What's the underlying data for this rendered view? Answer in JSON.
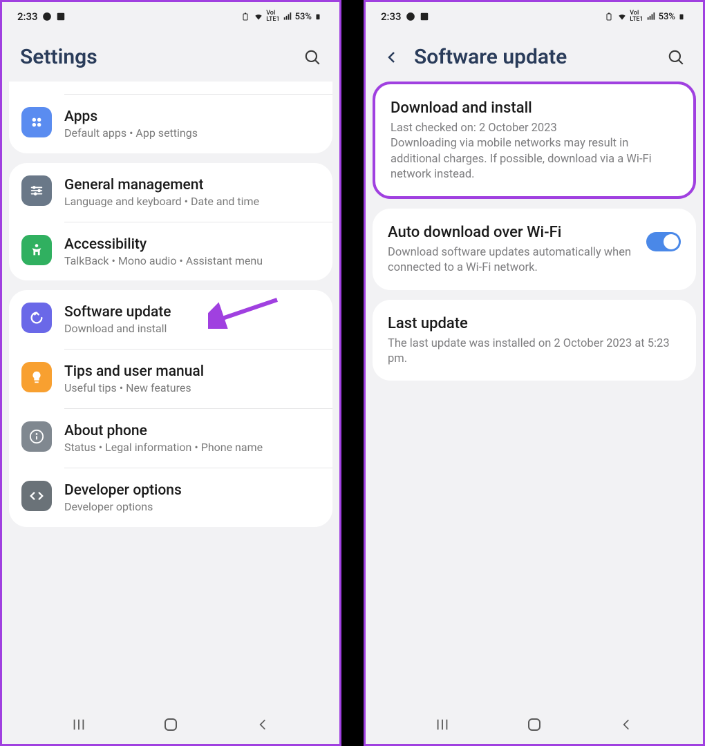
{
  "status": {
    "time": "2:33",
    "battery": "53%"
  },
  "left": {
    "title": "Settings",
    "apps": {
      "title": "Apps",
      "sub": "Default apps  •  App settings"
    },
    "general": {
      "title": "General management",
      "sub": "Language and keyboard  •  Date and time"
    },
    "accessibility": {
      "title": "Accessibility",
      "sub": "TalkBack  •  Mono audio  •  Assistant menu"
    },
    "software": {
      "title": "Software update",
      "sub": "Download and install"
    },
    "tips": {
      "title": "Tips and user manual",
      "sub": "Useful tips  •  New features"
    },
    "about": {
      "title": "About phone",
      "sub": "Status  •  Legal information  •  Phone name"
    },
    "dev": {
      "title": "Developer options",
      "sub": "Developer options"
    }
  },
  "right": {
    "title": "Software update",
    "download": {
      "title": "Download and install",
      "sub": "Last checked on: 2 October 2023\nDownloading via mobile networks may result in additional charges. If possible, download via a Wi-Fi network instead."
    },
    "auto": {
      "title": "Auto download over Wi-Fi",
      "sub": "Download software updates automatically when connected to a Wi-Fi network."
    },
    "last": {
      "title": "Last update",
      "sub": "The last update was installed on 2 October 2023 at 5:23 pm."
    }
  }
}
